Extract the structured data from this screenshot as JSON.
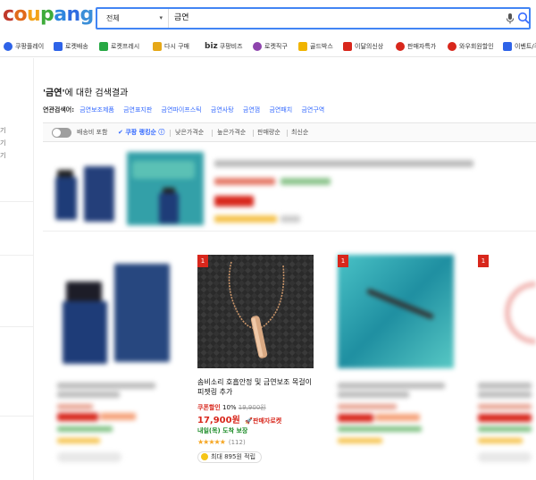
{
  "header": {
    "logo": "coupang",
    "search": {
      "category": "전체",
      "query": "금연"
    }
  },
  "nav": {
    "items": [
      {
        "label": "쿠팡플레이",
        "icon": "play-icon",
        "color": "#2e63e8"
      },
      {
        "label": "로켓배송",
        "icon": "rocket-icon",
        "color": "#2e63e8"
      },
      {
        "label": "로켓프레시",
        "icon": "rocket-fresh-icon",
        "color": "#27a844"
      },
      {
        "label": "다시 구매",
        "icon": "home-icon",
        "color": "#e6a817"
      },
      {
        "label": "쿠팡비즈",
        "icon": "biz-icon",
        "color": "#111111"
      },
      {
        "label": "로켓직구",
        "icon": "globe-icon",
        "color": "#8e44ad"
      },
      {
        "label": "골드박스",
        "icon": "gold-box-icon",
        "color": "#f0b400"
      },
      {
        "label": "이달의신상",
        "icon": "bag-icon",
        "color": "#d8271c"
      },
      {
        "label": "판매자특가",
        "icon": "percent-icon",
        "color": "#d8271c"
      },
      {
        "label": "와우회원할인",
        "icon": "wow-icon",
        "color": "#d8271c"
      },
      {
        "label": "이벤트/쿠",
        "icon": "event-icon",
        "color": "#2e63e8"
      }
    ]
  },
  "sidebar": {
    "fragments": [
      "기",
      "기",
      "기"
    ]
  },
  "results": {
    "keyword": "'금연'",
    "title_suffix": "에 대한 검색결과",
    "related_label": "연관검색어:",
    "related": [
      "금연보조제품",
      "금연표지판",
      "금연파이프스틱",
      "금연사탕",
      "금연껌",
      "금연패치",
      "금연구역"
    ]
  },
  "sort": {
    "delivery_fee_toggle": "배송비 포함",
    "options": [
      "쿠팡 랭킹순",
      "낮은가격순",
      "높은가격순",
      "판매량순",
      "최신순"
    ],
    "info_icon": "ⓘ"
  },
  "products": [
    {
      "rank": "",
      "name": "",
      "coupon": "",
      "discount": "",
      "original": "",
      "price": "",
      "rocket": "",
      "delivery": "",
      "stars": "",
      "reviews": "",
      "reward": ""
    },
    {
      "rank": "1",
      "name": "솜비소리 호흡안정 및 금연보조 목걸이 피젯링 추가",
      "coupon": "쿠폰할인",
      "discount": "10%",
      "original": "19,900원",
      "price": "17,900원",
      "rocket": "판매자로켓",
      "delivery": "내일(목) 도착 보장",
      "stars": "★★★★★",
      "reviews": "(112)",
      "reward": "최대 895원 적립"
    },
    {
      "rank": "1",
      "name": "",
      "coupon": "",
      "discount": "",
      "original": "",
      "price": "",
      "rocket": "",
      "delivery": "",
      "stars": "",
      "reviews": "",
      "reward": ""
    },
    {
      "rank": "1",
      "name": "",
      "coupon": "",
      "discount": "",
      "original": "",
      "price": "",
      "rocket": "",
      "delivery": "",
      "stars": "",
      "reviews": "",
      "reward": ""
    }
  ],
  "colors": {
    "brand_blue": "#346aff",
    "price_red": "#d8271c",
    "delivery_green": "#1b8b26",
    "search_border": "#4285f4"
  }
}
